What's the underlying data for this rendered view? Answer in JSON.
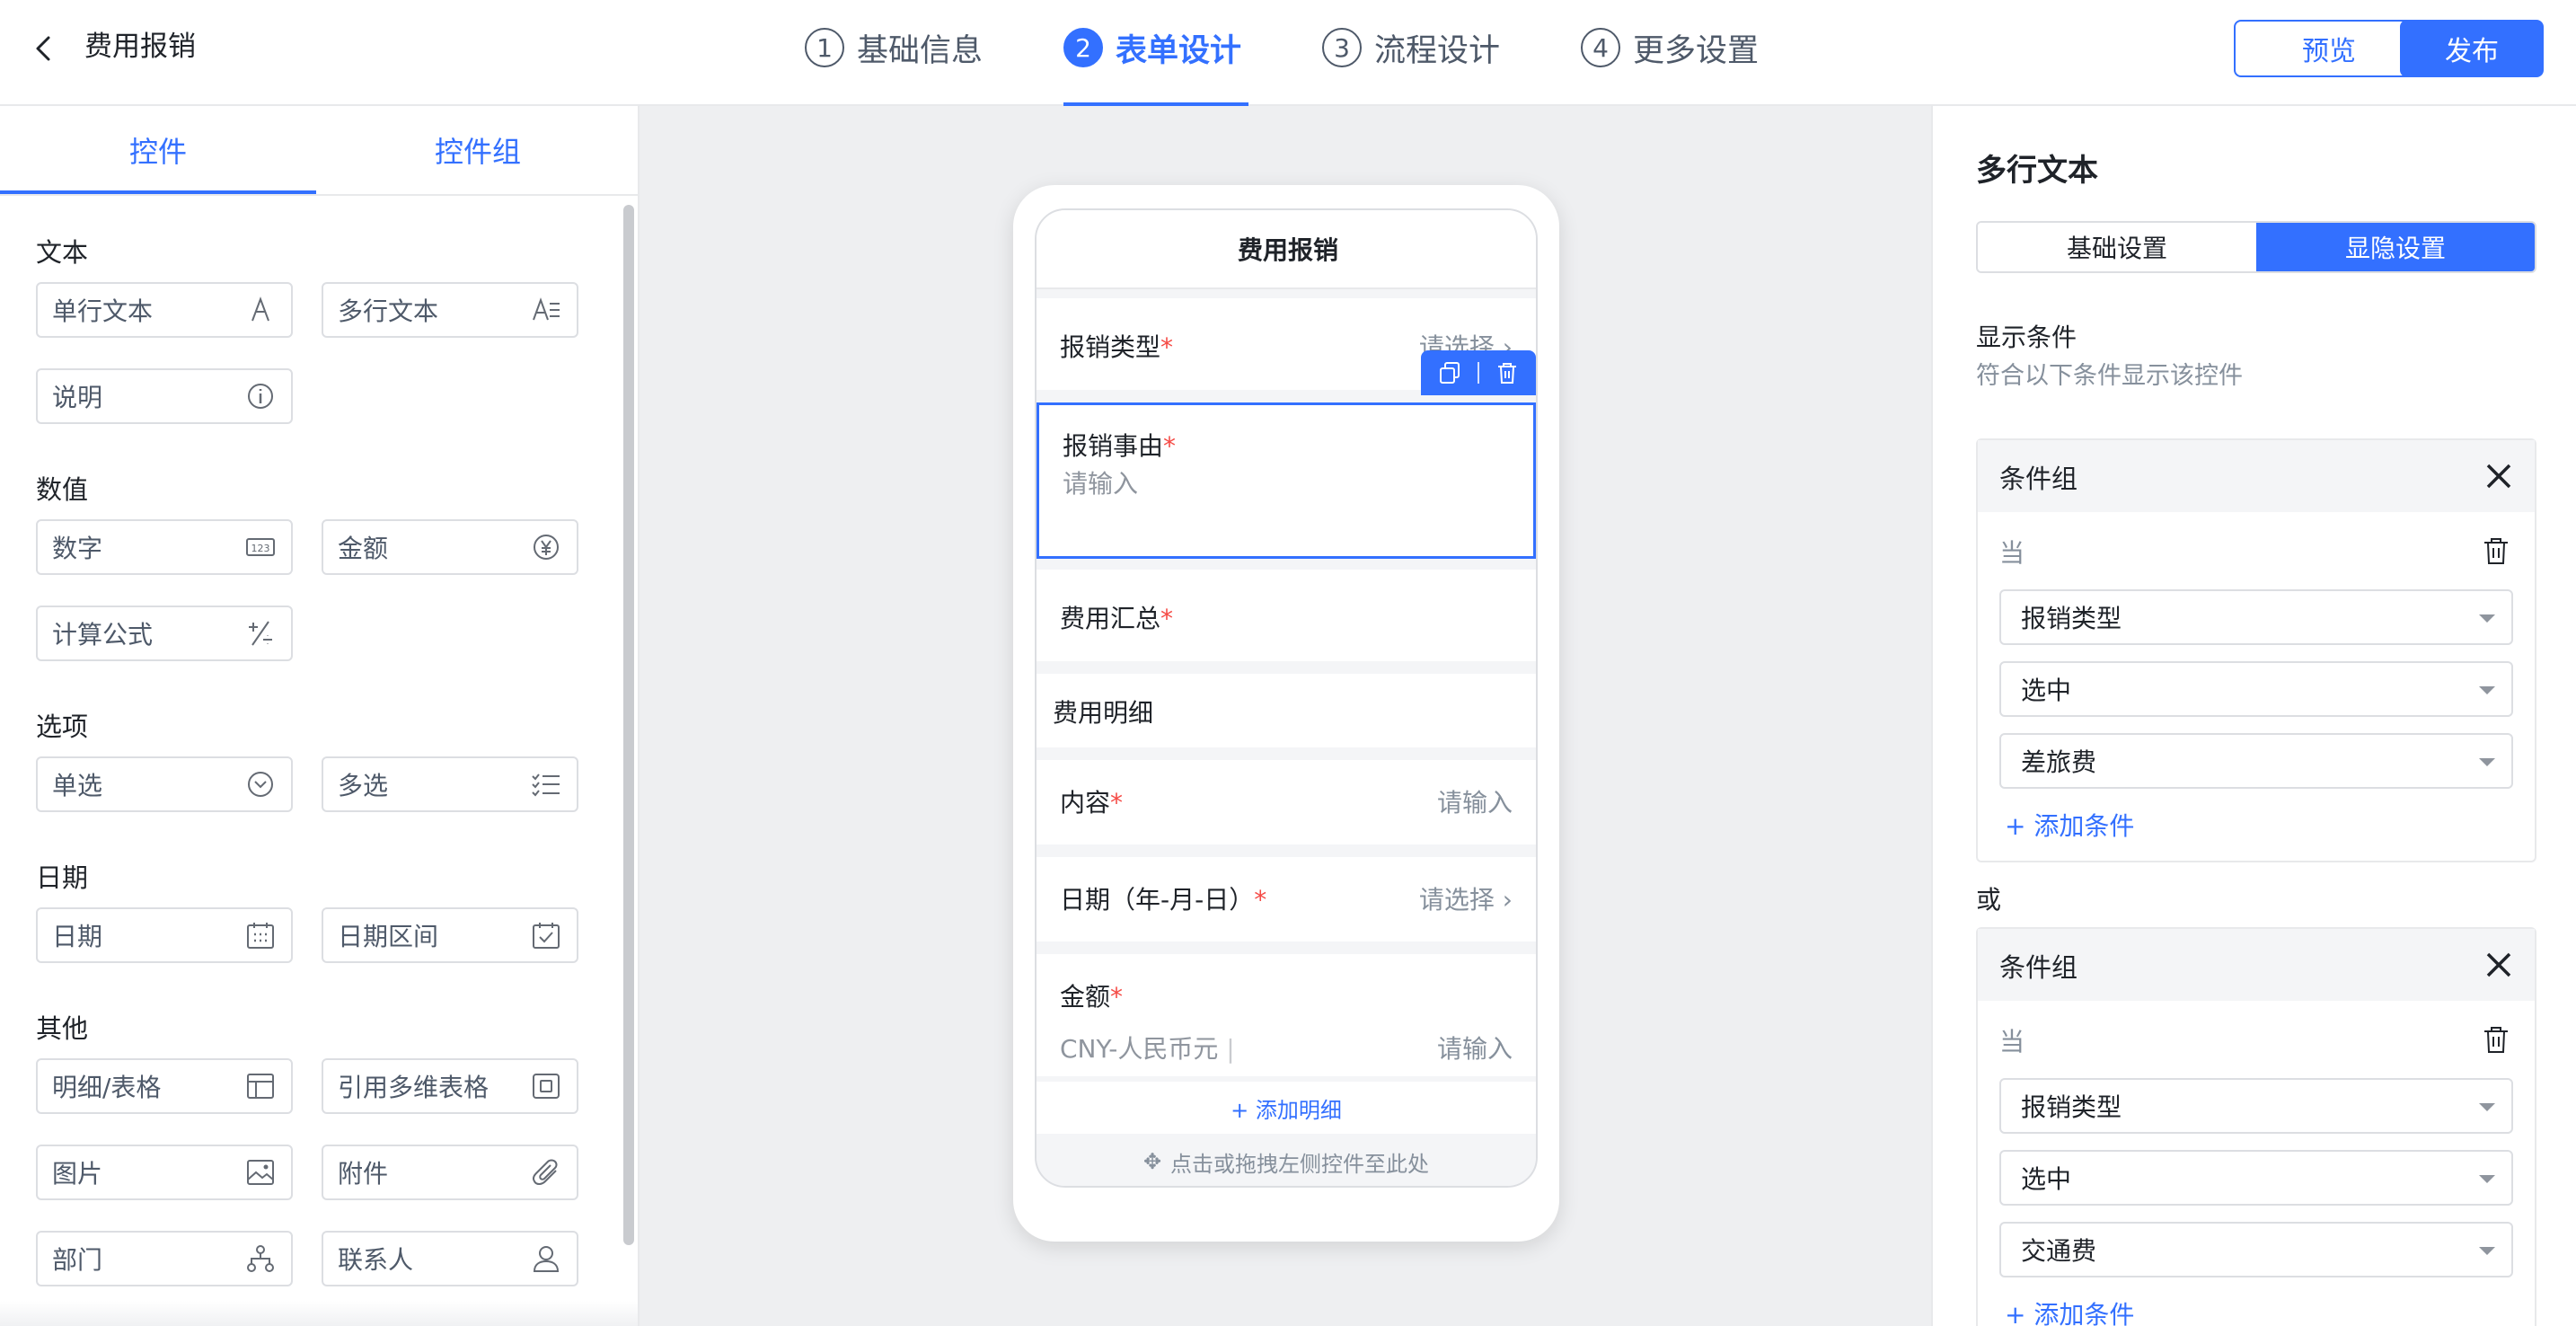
{
  "header": {
    "title": "费用报销",
    "steps": [
      {
        "num": "1",
        "label": "基础信息"
      },
      {
        "num": "2",
        "label": "表单设计"
      },
      {
        "num": "3",
        "label": "流程设计"
      },
      {
        "num": "4",
        "label": "更多设置"
      }
    ],
    "active_step": 2,
    "preview_label": "预览",
    "publish_label": "发布"
  },
  "left_panel": {
    "tabs": [
      "控件",
      "控件组"
    ],
    "active_tab": 0,
    "sections": [
      {
        "title": "文本",
        "items": [
          {
            "label": "单行文本",
            "icon": "single-line-text-icon"
          },
          {
            "label": "多行文本",
            "icon": "multi-line-text-icon"
          },
          {
            "label": "说明",
            "icon": "info-icon"
          }
        ]
      },
      {
        "title": "数值",
        "items": [
          {
            "label": "数字",
            "icon": "number-icon"
          },
          {
            "label": "金额",
            "icon": "currency-icon"
          },
          {
            "label": "计算公式",
            "icon": "formula-icon"
          }
        ]
      },
      {
        "title": "选项",
        "items": [
          {
            "label": "单选",
            "icon": "radio-icon"
          },
          {
            "label": "多选",
            "icon": "checklist-icon"
          }
        ]
      },
      {
        "title": "日期",
        "items": [
          {
            "label": "日期",
            "icon": "calendar-icon"
          },
          {
            "label": "日期区间",
            "icon": "date-range-icon"
          }
        ]
      },
      {
        "title": "其他",
        "items": [
          {
            "label": "明细/表格",
            "icon": "table-icon"
          },
          {
            "label": "引用多维表格",
            "icon": "reference-table-icon"
          },
          {
            "label": "图片",
            "icon": "image-icon"
          },
          {
            "label": "附件",
            "icon": "paperclip-icon"
          },
          {
            "label": "部门",
            "icon": "org-chart-icon"
          },
          {
            "label": "联系人",
            "icon": "user-icon"
          }
        ]
      }
    ]
  },
  "form_preview": {
    "title": "费用报销",
    "required_mark": "*",
    "fields": {
      "type": {
        "label": "报销类型",
        "value": "请选择"
      },
      "reason": {
        "label": "报销事由",
        "placeholder": "请输入"
      },
      "summary": {
        "label": "费用汇总"
      },
      "detail_title": "费用明细",
      "content": {
        "label": "内容",
        "value": "请输入"
      },
      "date": {
        "label": "日期（年-月-日）",
        "value": "请选择"
      },
      "amount": {
        "label": "金额",
        "currency": "CNY-人民币元",
        "value": "请输入"
      }
    },
    "add_detail": "+ 添加明细",
    "drop_hint": "点击或拖拽左侧控件至此处"
  },
  "right_panel": {
    "title": "多行文本",
    "tabs": [
      "基础设置",
      "显隐设置"
    ],
    "active_tab": 1,
    "show_condition_label": "显示条件",
    "show_condition_hint": "符合以下条件显示该控件",
    "or_label": "或",
    "groups": [
      {
        "title": "条件组",
        "when": "当",
        "field": "报销类型",
        "operator": "选中",
        "value": "差旅费",
        "add_label": "+ 添加条件"
      },
      {
        "title": "条件组",
        "when": "当",
        "field": "报销类型",
        "operator": "选中",
        "value": "交通费",
        "add_label": "+ 添加条件"
      }
    ]
  },
  "colors": {
    "accent": "#3370ff",
    "required": "#f54a45",
    "canvas_bg": "#eeeff1"
  }
}
